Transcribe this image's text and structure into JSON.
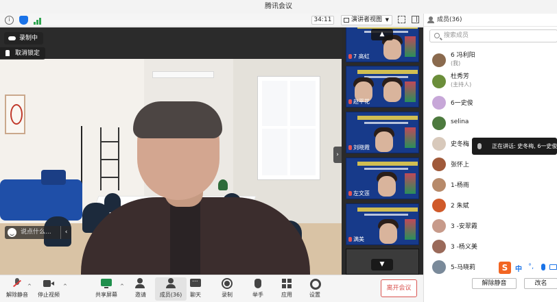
{
  "window": {
    "title": "腾讯会议"
  },
  "toolbar": {
    "timer": "34:11",
    "view_label": "演讲者视图"
  },
  "main_video": {
    "recording_label": "录制中",
    "unpin_label": "取消锁定",
    "chat_placeholder": "说点什么..."
  },
  "thumbnails": [
    {
      "name": "7 高虹",
      "muted": true
    },
    {
      "name": "赵平花",
      "muted": true
    },
    {
      "name": "刘晓霞",
      "muted": true
    },
    {
      "name": "左文莲",
      "muted": true
    },
    {
      "name": "满美",
      "muted": true
    }
  ],
  "bottombar": {
    "mute_label": "解除静音",
    "video_label": "停止视频",
    "share_label": "共享屏幕",
    "invite_label": "邀请",
    "members_label": "成员(36)",
    "chat_label": "聊天",
    "record_label": "录制",
    "raise_hand_label": "举手",
    "apps_label": "应用",
    "settings_label": "设置",
    "leave_label": "离开会议"
  },
  "members_panel": {
    "title": "成员(36)",
    "search_placeholder": "搜索成员",
    "members": [
      {
        "name": "6 冯利阳",
        "role": "(我)",
        "avatar_color": "#8a6a4e"
      },
      {
        "name": "杜秀芳",
        "role": "(主持人)",
        "avatar_color": "#6b8e3a"
      },
      {
        "name": "6一史俊",
        "role": "",
        "avatar_color": "#c7a7d8"
      },
      {
        "name": "selina",
        "role": "",
        "avatar_color": "#4d7a3e"
      },
      {
        "name": "史冬梅",
        "role": "",
        "avatar_color": "#d8c9bb"
      },
      {
        "name": "张怀上",
        "role": "",
        "avatar_color": "#a05a3a"
      },
      {
        "name": "1-杨雨",
        "role": "",
        "avatar_color": "#b78a6a"
      },
      {
        "name": "2 朱斌",
        "role": "",
        "avatar_color": "#d05a2a"
      },
      {
        "name": "3 -安翠霞",
        "role": "",
        "avatar_color": "#c79a8a"
      },
      {
        "name": "3 -杨义美",
        "role": "",
        "avatar_color": "#9a6a5a"
      },
      {
        "name": "5-马晓莉",
        "role": "",
        "avatar_color": "#7a8a9a"
      }
    ],
    "speaking_text": "正在讲话: 史冬梅, 6一史俊",
    "mute_all_label": "解除静音",
    "rename_label": "改名"
  },
  "ime": {
    "lang": "中",
    "punct": "°,"
  },
  "colors": {
    "accent": "#1a73e8",
    "leave": "#d9534f",
    "share_green": "#1f8f4c"
  }
}
